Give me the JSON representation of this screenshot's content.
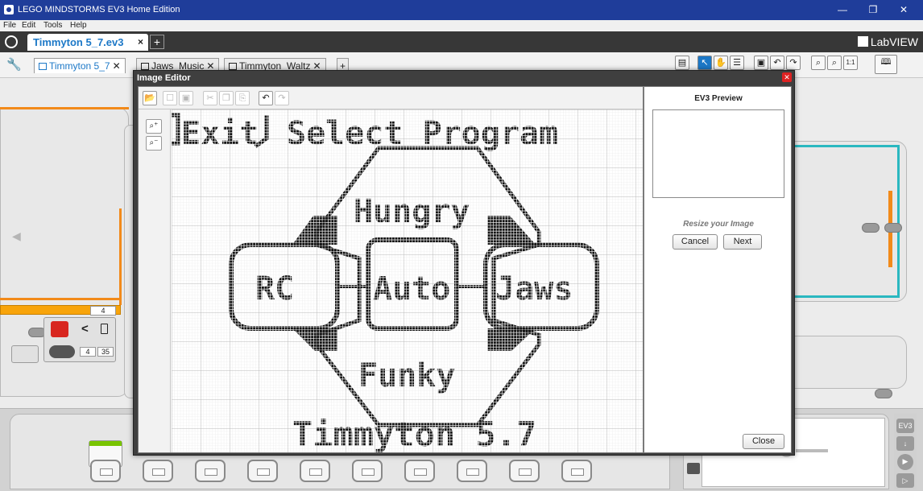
{
  "window": {
    "title": "LEGO MINDSTORMS EV3 Home Edition",
    "minimize": "—",
    "restore": "❐",
    "close": "✕"
  },
  "menu": [
    "File",
    "Edit",
    "Tools",
    "Help"
  ],
  "project": {
    "tab_label": "Timmyton 5_7.ev3",
    "tab_close": "×",
    "add": "+",
    "brand": "LabVIEW"
  },
  "program_tabs": [
    {
      "label": "Timmyton 5_7",
      "active": true
    },
    {
      "label": "Jaws_Music",
      "active": false
    },
    {
      "label": "Timmyton_Waltz",
      "active": false
    }
  ],
  "program_add": "+",
  "toolbar_right": {
    "zoom_reset": "1:1"
  },
  "canvas_blocks": {
    "top_value": "4",
    "compare_symbol": "<",
    "port_value": "4",
    "threshold_value": "35"
  },
  "image_editor": {
    "title": "Image Editor",
    "canvas_text": {
      "exit": "Exit",
      "heading": "Select Program",
      "top": "Hungry",
      "left": "RC",
      "center": "Auto",
      "right": "Jaws",
      "bottom": "Funky",
      "footer": "Timmyton 5.7"
    },
    "preview_title": "EV3 Preview",
    "resize_label": "Resize your Image",
    "cancel_label": "Cancel",
    "next_label": "Next",
    "close_label": "Close"
  },
  "hardware_panel": {
    "ev3_label": "EV3"
  },
  "colors": {
    "title_bar": "#1f3d9a",
    "project_bar": "#373737",
    "tab_blue": "#1c78c7",
    "orange_wire": "#f28a1a",
    "teal_wire": "#2ab8c0",
    "block_yellow": "#f8a40a",
    "pixel_ink": "#111111"
  }
}
